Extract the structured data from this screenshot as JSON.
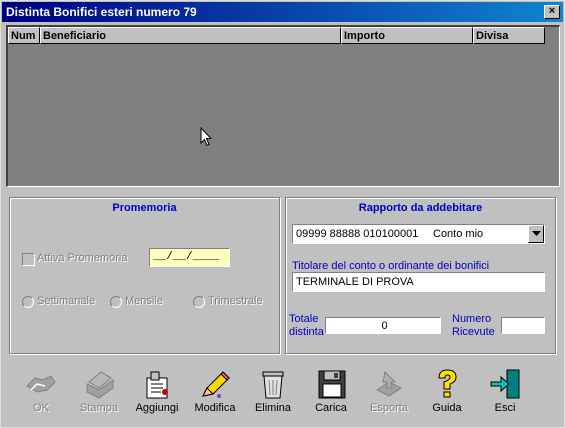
{
  "window": {
    "title": "Distinta Bonifici esteri numero 79",
    "close_glyph": "×"
  },
  "grid": {
    "columns": [
      "Num",
      "Beneficiario",
      "Importo",
      "Divisa"
    ]
  },
  "promemoria": {
    "title": "Promemoria",
    "attiva_label": "Attiva Promemoria",
    "date_value": "__/__/____",
    "radios": [
      "Settimanale",
      "Mensile",
      "Trimestrale"
    ]
  },
  "rapporto": {
    "title": "Rapporto da addebitare",
    "selected_account": "09999 88888 010100001",
    "selected_desc": "Conto mio",
    "titolare_label": "Titolare del conto o ordinante dei bonifici",
    "titolare_value": "TERMINALE DI PROVA",
    "totale_label_1": "Totale",
    "totale_label_2": "distinta",
    "totale_value": "0",
    "numero_label_1": "Numero",
    "numero_label_2": "Ricevute",
    "numero_value": ""
  },
  "toolbar": {
    "ok": "OK",
    "stampa": "Stampa",
    "aggiungi": "Aggiungi",
    "modifica": "Modifica",
    "elimina": "Elimina",
    "carica": "Carica",
    "esporta": "Esporta",
    "guida": "Guida",
    "esci": "Esci"
  },
  "colors": {
    "title_start": "#000080",
    "title_end": "#1084d0",
    "panel_title": "#0000c0",
    "date_bg": "#ffffc0"
  }
}
